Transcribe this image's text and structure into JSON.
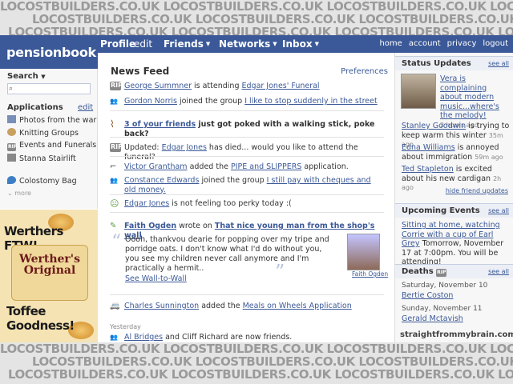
{
  "watermark": {
    "text": "LOCOSTBUILDERS.CO.UK  LOCOSTBUILDERS.CO.UK  LOCOSTBUILDERS.CO.UK  LOCOSTBUILDERS.CO.UK  LOCOSTBUILDERS.CO.UK"
  },
  "header": {
    "brand": "pensionbook",
    "nav": [
      "Profile",
      "edit",
      "Friends",
      "Networks",
      "Inbox"
    ],
    "right": [
      "home",
      "account",
      "privacy",
      "logout"
    ]
  },
  "sidebar": {
    "search_label": "Search",
    "apps_label": "Applications",
    "edit_label": "edit",
    "items": [
      "Photos from the war",
      "Knitting Groups",
      "Events and Funerals",
      "Stanna Stairlift",
      "Colostomy Bag"
    ],
    "more_label": "more"
  },
  "ad": {
    "headline": "Werthers FTW!",
    "logo": "Werther's Original",
    "tagline": "Toffee Goodness!"
  },
  "main": {
    "title": "News Feed",
    "preferences": "Preferences",
    "feed": {
      "f1": {
        "a": "George Summner",
        "b": " is attending ",
        "c": "Edgar Jones' Funeral"
      },
      "f2": {
        "a": "Gordon Norris",
        "b": " joined the group ",
        "c": "I like to stop suddenly in the street"
      },
      "f3": {
        "a": "3 of your friends",
        "b": " just got poked with a walking stick, poke back?"
      },
      "f4": {
        "pre": "Updated: ",
        "a": "Edgar Jones",
        "b": " has died... would you like to attend the funeral?"
      },
      "f5": {
        "a": "Victor Grantham",
        "b": "  added the ",
        "c": "PIPE and SLIPPERS",
        "d": " application."
      },
      "f6": {
        "a": "Constance Edwards",
        "b": "  joined the group ",
        "c": "I still pay with cheques and old money."
      },
      "f7": {
        "a": "Edgar Jones",
        "b": " is not feeling too perky today :("
      },
      "f8": {
        "a": "Faith Ogden",
        "b": " wrote on ",
        "c": "That nice young man from the shop's wall"
      },
      "wall": "Oooh, thankvou dearie for popping over my tripe and porridge oats. I don't know what I'd do without you, you see my children never call anymore and I'm practically a hermit..",
      "see_wall": "See Wall-to-Wall",
      "photo_caption": "Faith Ogden",
      "f9": {
        "a": "Charles Sunnington",
        "b": " added the ",
        "c": "Meals on Wheels Application"
      },
      "yesterday": "Yesterday",
      "f10": {
        "a": "Al Bridges",
        "b": " and Cliff Richard are now friends."
      }
    }
  },
  "right": {
    "status_title": "Status Updates",
    "see_all": "see all",
    "s1": {
      "text": "Vera is complaining about modern music...where's the melody!",
      "time": "2 hours ago"
    },
    "s2": {
      "name": "Stanley Goodwin",
      "text": " is trying to keep warm this winter ",
      "time": "35m ago"
    },
    "s3": {
      "name": "Edna Williams",
      "text": " is annoyed about immigration",
      "time": "59m ago"
    },
    "s4": {
      "name": "Ted Stapleton",
      "text": " is excited about his new cardigan ",
      "time": "2h ago"
    },
    "hide": "hide friend updates",
    "events_title": "Upcoming Events",
    "event": {
      "link": "Sitting at home, watching Corrie with a cup of Earl Grey",
      "text": "Tomorrow, November 17 at 7:00pm. You will be attending!"
    },
    "deaths_title": "Deaths",
    "d1": {
      "date": "Saturday, November 10",
      "name": "Bertie Coston"
    },
    "d2": {
      "date": "Sunday, November 11",
      "name": "Gerald Mctavish"
    },
    "footer": "straightfrommybrain.com"
  }
}
